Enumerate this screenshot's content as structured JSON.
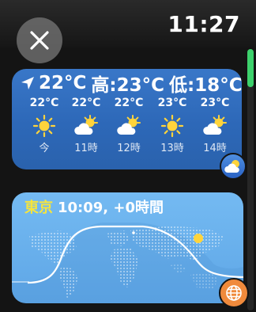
{
  "status": {
    "time": "11:27"
  },
  "weather": {
    "current_temp": "22°C",
    "high": "高:23°C",
    "low": "低:18°C",
    "hourly": [
      {
        "temp": "22°C",
        "icon": "sun-icon",
        "label": "今"
      },
      {
        "temp": "22°C",
        "icon": "partly-cloudy-icon",
        "label": "11時"
      },
      {
        "temp": "22°C",
        "icon": "partly-cloudy-icon",
        "label": "12時"
      },
      {
        "temp": "23°C",
        "icon": "sun-icon",
        "label": "13時"
      },
      {
        "temp": "23°C",
        "icon": "partly-cloudy-icon",
        "label": "14時"
      }
    ]
  },
  "world_clock": {
    "city": "東京",
    "time_offset": "10:09, +0時間"
  },
  "colors": {
    "weather_card": "#3572c2",
    "clock_card": "#6cb3ee",
    "city_highlight": "#f6e53c",
    "scroll_thumb": "#3dd16c",
    "globe_badge": "#f08a3c"
  }
}
